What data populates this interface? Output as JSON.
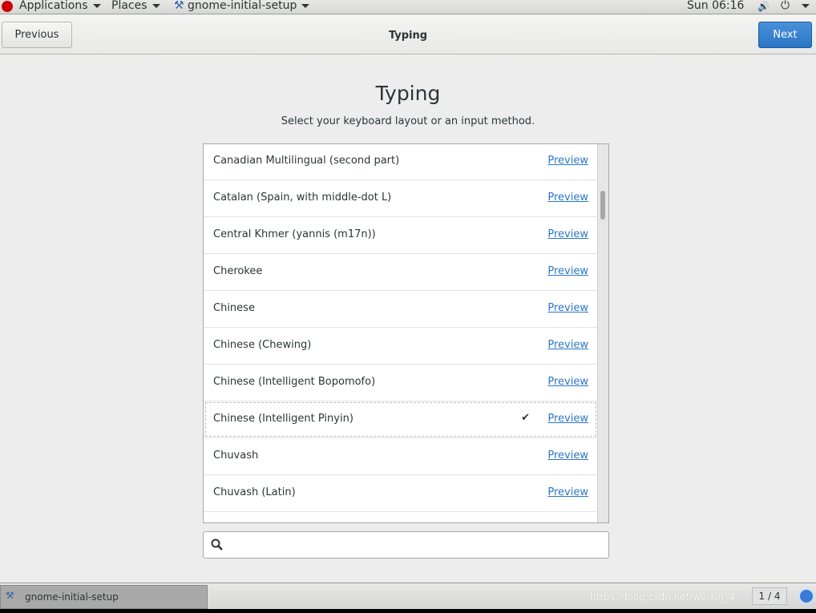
{
  "topbar": {
    "applications": "Applications",
    "places": "Places",
    "app": "gnome-initial-setup",
    "clock": "Sun 06:16"
  },
  "header": {
    "previous": "Previous",
    "title": "Typing",
    "next": "Next"
  },
  "main": {
    "heading": "Typing",
    "subtitle": "Select your keyboard layout or an input method.",
    "items": [
      {
        "label": "Canadian Multilingual (second part)",
        "preview": "Preview"
      },
      {
        "label": "Catalan (Spain, with middle-dot L)",
        "preview": "Preview"
      },
      {
        "label": "Central Khmer (yannis (m17n))",
        "preview": "Preview"
      },
      {
        "label": "Cherokee",
        "preview": "Preview"
      },
      {
        "label": "Chinese",
        "preview": "Preview"
      },
      {
        "label": "Chinese (Chewing)",
        "preview": "Preview"
      },
      {
        "label": "Chinese (Intelligent Bopomofo)",
        "preview": "Preview"
      },
      {
        "label": "Chinese (Intelligent Pinyin)",
        "preview": "Preview",
        "selected": true
      },
      {
        "label": "Chuvash",
        "preview": "Preview"
      },
      {
        "label": "Chuvash (Latin)",
        "preview": "Preview"
      }
    ],
    "search": {
      "value": "",
      "placeholder": ""
    }
  },
  "taskbar": {
    "window": "gnome-initial-setup",
    "workspace": "1 / 4",
    "watermark": "https://blog.csdn.net/weixin_4"
  },
  "colors": {
    "accent": "#2a76c6",
    "link": "#2a76c6"
  }
}
